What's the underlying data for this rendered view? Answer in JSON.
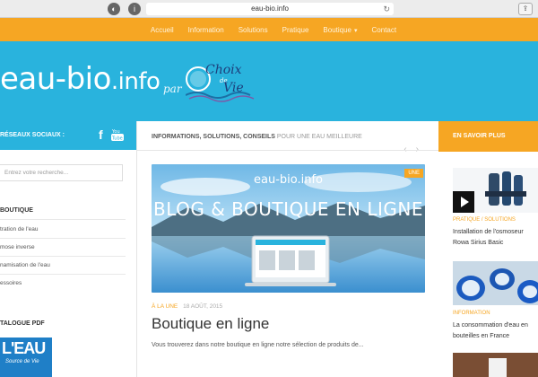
{
  "browser": {
    "url": "eau-bio.info",
    "reload_icon": "reload-icon",
    "share_icon": "share-icon"
  },
  "nav": {
    "items": [
      {
        "label": "Accueil"
      },
      {
        "label": "Information"
      },
      {
        "label": "Solutions"
      },
      {
        "label": "Pratique"
      },
      {
        "label": "Boutique"
      },
      {
        "label": "Contact"
      }
    ],
    "accent": "#f6a623"
  },
  "header": {
    "site_name": "eau-bio",
    "site_tld": ".info",
    "par": "par",
    "partner_logo_text": "Choix de Vie",
    "bg_color": "#29b3dd"
  },
  "left": {
    "social_title": "RÉSEAUX SOCIAUX :",
    "search_placeholder": "Entrez votre recherche...",
    "boutique_title": "BOUTIQUE",
    "items": [
      {
        "label": "tration de l'eau"
      },
      {
        "label": "mose inverse"
      },
      {
        "label": "namisation de l'eau"
      },
      {
        "label": "essoires"
      }
    ],
    "catalog_title": "TALOGUE PDF",
    "catalog_cover_big": "L'EAU",
    "catalog_cover_sub": "Source de Vie"
  },
  "main": {
    "section_bold": "INFORMATIONS, SOLUTIONS, CONSEILS",
    "section_light": "POUR UNE EAU MEILLEURE",
    "hero_badge": "UNE",
    "hero_brand": "eau-bio.info",
    "hero_title": "BLOG & BOUTIQUE EN LIGNE",
    "post_category": "À LA UNE",
    "post_date": "18 AOÛT, 2015",
    "post_title": "Boutique en ligne",
    "post_excerpt": "Vous trouverez dans notre boutique en ligne notre sélection de produits de..."
  },
  "right": {
    "title": "EN SAVOIR PLUS",
    "posts": [
      {
        "category": "PRATIQUE / SOLUTIONS",
        "title": "Installation de l'osmoseur Rowa Sirius Basic"
      },
      {
        "category": "INFORMATION",
        "title": "La consommation d'eau en bouteilles en France"
      }
    ]
  }
}
